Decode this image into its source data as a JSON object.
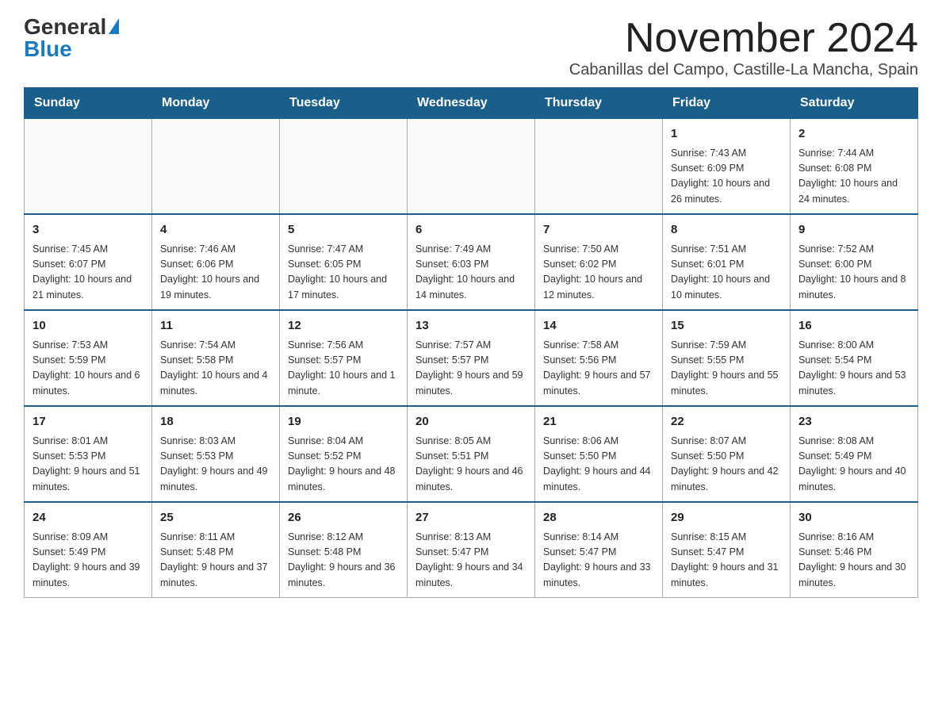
{
  "logo": {
    "general": "General",
    "triangle": "▶",
    "blue": "Blue"
  },
  "title": "November 2024",
  "subtitle": "Cabanillas del Campo, Castille-La Mancha, Spain",
  "headers": [
    "Sunday",
    "Monday",
    "Tuesday",
    "Wednesday",
    "Thursday",
    "Friday",
    "Saturday"
  ],
  "weeks": [
    [
      {
        "day": "",
        "info": ""
      },
      {
        "day": "",
        "info": ""
      },
      {
        "day": "",
        "info": ""
      },
      {
        "day": "",
        "info": ""
      },
      {
        "day": "",
        "info": ""
      },
      {
        "day": "1",
        "info": "Sunrise: 7:43 AM\nSunset: 6:09 PM\nDaylight: 10 hours and 26 minutes."
      },
      {
        "day": "2",
        "info": "Sunrise: 7:44 AM\nSunset: 6:08 PM\nDaylight: 10 hours and 24 minutes."
      }
    ],
    [
      {
        "day": "3",
        "info": "Sunrise: 7:45 AM\nSunset: 6:07 PM\nDaylight: 10 hours and 21 minutes."
      },
      {
        "day": "4",
        "info": "Sunrise: 7:46 AM\nSunset: 6:06 PM\nDaylight: 10 hours and 19 minutes."
      },
      {
        "day": "5",
        "info": "Sunrise: 7:47 AM\nSunset: 6:05 PM\nDaylight: 10 hours and 17 minutes."
      },
      {
        "day": "6",
        "info": "Sunrise: 7:49 AM\nSunset: 6:03 PM\nDaylight: 10 hours and 14 minutes."
      },
      {
        "day": "7",
        "info": "Sunrise: 7:50 AM\nSunset: 6:02 PM\nDaylight: 10 hours and 12 minutes."
      },
      {
        "day": "8",
        "info": "Sunrise: 7:51 AM\nSunset: 6:01 PM\nDaylight: 10 hours and 10 minutes."
      },
      {
        "day": "9",
        "info": "Sunrise: 7:52 AM\nSunset: 6:00 PM\nDaylight: 10 hours and 8 minutes."
      }
    ],
    [
      {
        "day": "10",
        "info": "Sunrise: 7:53 AM\nSunset: 5:59 PM\nDaylight: 10 hours and 6 minutes."
      },
      {
        "day": "11",
        "info": "Sunrise: 7:54 AM\nSunset: 5:58 PM\nDaylight: 10 hours and 4 minutes."
      },
      {
        "day": "12",
        "info": "Sunrise: 7:56 AM\nSunset: 5:57 PM\nDaylight: 10 hours and 1 minute."
      },
      {
        "day": "13",
        "info": "Sunrise: 7:57 AM\nSunset: 5:57 PM\nDaylight: 9 hours and 59 minutes."
      },
      {
        "day": "14",
        "info": "Sunrise: 7:58 AM\nSunset: 5:56 PM\nDaylight: 9 hours and 57 minutes."
      },
      {
        "day": "15",
        "info": "Sunrise: 7:59 AM\nSunset: 5:55 PM\nDaylight: 9 hours and 55 minutes."
      },
      {
        "day": "16",
        "info": "Sunrise: 8:00 AM\nSunset: 5:54 PM\nDaylight: 9 hours and 53 minutes."
      }
    ],
    [
      {
        "day": "17",
        "info": "Sunrise: 8:01 AM\nSunset: 5:53 PM\nDaylight: 9 hours and 51 minutes."
      },
      {
        "day": "18",
        "info": "Sunrise: 8:03 AM\nSunset: 5:53 PM\nDaylight: 9 hours and 49 minutes."
      },
      {
        "day": "19",
        "info": "Sunrise: 8:04 AM\nSunset: 5:52 PM\nDaylight: 9 hours and 48 minutes."
      },
      {
        "day": "20",
        "info": "Sunrise: 8:05 AM\nSunset: 5:51 PM\nDaylight: 9 hours and 46 minutes."
      },
      {
        "day": "21",
        "info": "Sunrise: 8:06 AM\nSunset: 5:50 PM\nDaylight: 9 hours and 44 minutes."
      },
      {
        "day": "22",
        "info": "Sunrise: 8:07 AM\nSunset: 5:50 PM\nDaylight: 9 hours and 42 minutes."
      },
      {
        "day": "23",
        "info": "Sunrise: 8:08 AM\nSunset: 5:49 PM\nDaylight: 9 hours and 40 minutes."
      }
    ],
    [
      {
        "day": "24",
        "info": "Sunrise: 8:09 AM\nSunset: 5:49 PM\nDaylight: 9 hours and 39 minutes."
      },
      {
        "day": "25",
        "info": "Sunrise: 8:11 AM\nSunset: 5:48 PM\nDaylight: 9 hours and 37 minutes."
      },
      {
        "day": "26",
        "info": "Sunrise: 8:12 AM\nSunset: 5:48 PM\nDaylight: 9 hours and 36 minutes."
      },
      {
        "day": "27",
        "info": "Sunrise: 8:13 AM\nSunset: 5:47 PM\nDaylight: 9 hours and 34 minutes."
      },
      {
        "day": "28",
        "info": "Sunrise: 8:14 AM\nSunset: 5:47 PM\nDaylight: 9 hours and 33 minutes."
      },
      {
        "day": "29",
        "info": "Sunrise: 8:15 AM\nSunset: 5:47 PM\nDaylight: 9 hours and 31 minutes."
      },
      {
        "day": "30",
        "info": "Sunrise: 8:16 AM\nSunset: 5:46 PM\nDaylight: 9 hours and 30 minutes."
      }
    ]
  ]
}
